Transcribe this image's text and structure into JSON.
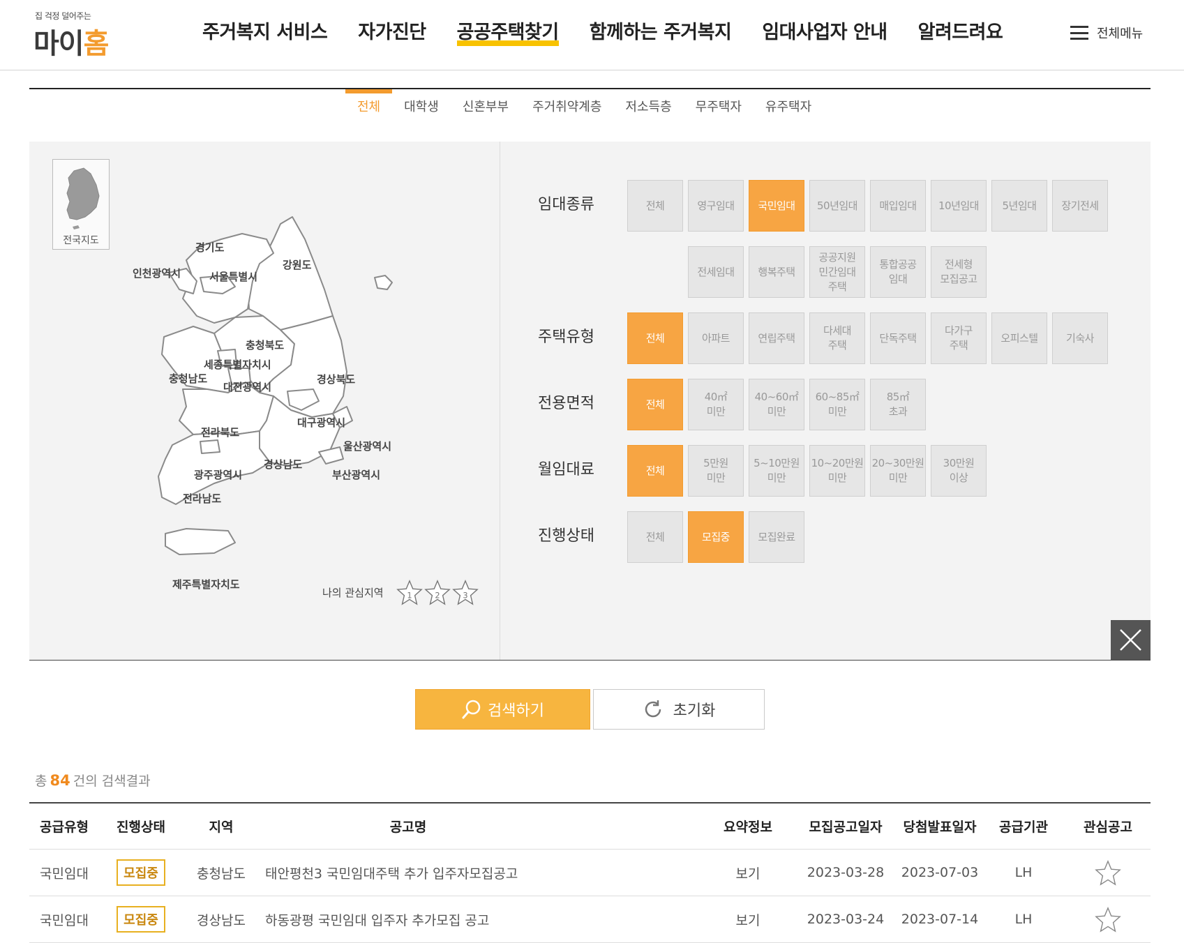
{
  "header": {
    "logo_tagline": "집 걱정 덜어주는",
    "logo_main_1": "마이",
    "logo_main_2": "홈",
    "nav": [
      "주거복지 서비스",
      "자가진단",
      "공공주택찾기",
      "함께하는 주거복지",
      "임대사업자 안내",
      "알려드려요"
    ],
    "nav_active_index": 2,
    "all_menu_label": "전체메뉴"
  },
  "tabs": {
    "items": [
      "전체",
      "대학생",
      "신혼부부",
      "주거취약계층",
      "저소득층",
      "무주택자",
      "유주택자"
    ],
    "active_index": 0
  },
  "map": {
    "nation_button_label": "전국지도",
    "regions": [
      "경기도",
      "강원도",
      "인천광역시",
      "서울특별시",
      "충청북도",
      "세종특별자치시",
      "충청남도",
      "대전광역시",
      "경상북도",
      "대구광역시",
      "전라북도",
      "울산광역시",
      "경상남도",
      "광주광역시",
      "부산광역시",
      "전라남도",
      "제주특별자치도"
    ],
    "favorites_label": "나의 관심지역",
    "favorite_slots": [
      "1",
      "2",
      "3"
    ]
  },
  "filters": {
    "rent_type": {
      "title": "임대종류",
      "row1": [
        "전체",
        "영구임대",
        "국민임대",
        "50년임대",
        "매입임대",
        "10년임대",
        "5년임대",
        "장기전세"
      ],
      "row2": [
        "전세임대",
        "행복주택",
        "공공지원\n민간임대\n주택",
        "통합공공\n임대",
        "전세형\n모집공고"
      ],
      "selected": "국민임대"
    },
    "house_type": {
      "title": "주택유형",
      "options": [
        "전체",
        "아파트",
        "연립주택",
        "다세대\n주택",
        "단독주택",
        "다가구\n주택",
        "오피스텔",
        "기숙사"
      ],
      "selected": "전체"
    },
    "area": {
      "title": "전용면적",
      "options": [
        "전체",
        "40㎡\n미만",
        "40~60㎡\n미만",
        "60~85㎡\n미만",
        "85㎡\n초과"
      ],
      "selected": "전체"
    },
    "monthly_rent": {
      "title": "월임대료",
      "options": [
        "전체",
        "5만원\n미만",
        "5~10만원\n미만",
        "10~20만원\n미만",
        "20~30만원\n미만",
        "30만원\n이상"
      ],
      "selected": "전체"
    },
    "status": {
      "title": "진행상태",
      "options": [
        "전체",
        "모집중",
        "모집완료"
      ],
      "selected": "모집중"
    }
  },
  "actions": {
    "search_label": "검색하기",
    "reset_label": "초기화"
  },
  "results": {
    "count_prefix": "총",
    "count": "84",
    "count_suffix": "건의 검색결과",
    "columns": [
      "공급유형",
      "진행상태",
      "지역",
      "공고명",
      "요약정보",
      "모집공고일자",
      "당첨발표일자",
      "공급기관",
      "관심공고"
    ],
    "rows": [
      {
        "type": "국민임대",
        "status": "모집중",
        "region": "충청남도",
        "title": "태안평천3 국민임대주택 추가 입주자모집공고",
        "summary": "보기",
        "notice_date": "2023-03-28",
        "announce_date": "2023-07-03",
        "agency": "LH"
      },
      {
        "type": "국민임대",
        "status": "모집중",
        "region": "경상남도",
        "title": "하동광평 국민임대 입주자 추가모집 공고",
        "summary": "보기",
        "notice_date": "2023-03-24",
        "announce_date": "2023-07-14",
        "agency": "LH"
      }
    ]
  },
  "colors": {
    "accent": "#f7a543",
    "brand_orange": "#f39b2e",
    "nav_highlight": "#f8c200",
    "badge_border": "#e8b020"
  }
}
